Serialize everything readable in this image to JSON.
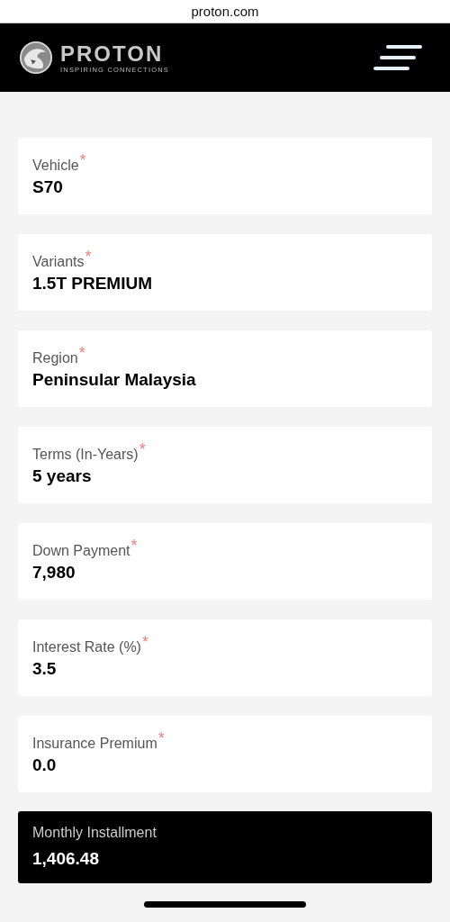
{
  "browser": {
    "url": "proton.com"
  },
  "header": {
    "brand": "PROTON",
    "tagline": "INSPIRING CONNECTIONS"
  },
  "required_mark": "*",
  "fields": [
    {
      "kind": "field",
      "label": "Vehicle",
      "required": true,
      "value": "S70"
    },
    {
      "kind": "field",
      "label": "Variants",
      "required": true,
      "value": "1.5T PREMIUM"
    },
    {
      "kind": "field",
      "label": "Region",
      "required": true,
      "value": "Peninsular Malaysia"
    },
    {
      "kind": "field",
      "label": "Terms (In-Years)",
      "required": true,
      "value": "5 years"
    },
    {
      "kind": "field",
      "label": "Down Payment",
      "required": true,
      "value": "7,980"
    },
    {
      "kind": "field",
      "label": "Interest Rate (%)",
      "required": true,
      "value": "3.5"
    },
    {
      "kind": "field",
      "label": "Insurance Premium",
      "required": true,
      "value": "0.0"
    },
    {
      "kind": "result",
      "label": "Monthly Installment",
      "required": false,
      "value": "1,406.48"
    }
  ]
}
